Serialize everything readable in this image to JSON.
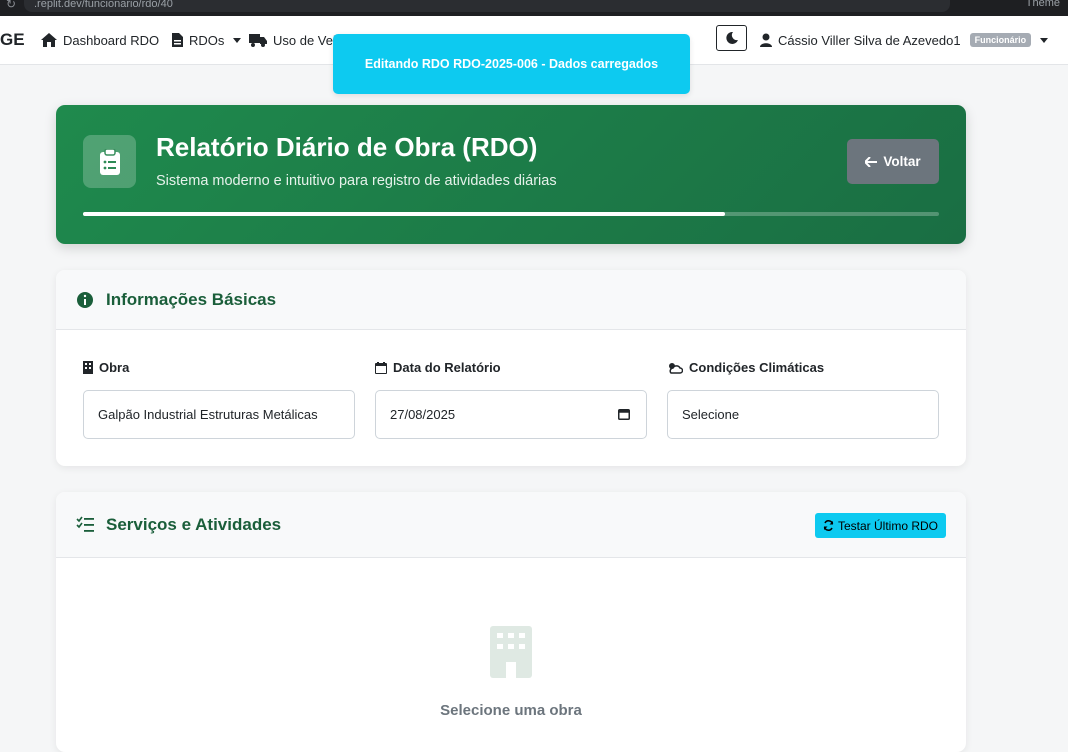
{
  "browser": {
    "url": ".replit.dev/funcionario/rdo/40",
    "theme_label": "Theme"
  },
  "navbar": {
    "brand": "GE",
    "dashboard_label": "Dashboard RDO",
    "rdos_label": "RDOs",
    "vehicles_label": "Uso de Vei",
    "user_name": "Cássio Viller Silva de Azevedo1",
    "user_role": "Funcionário"
  },
  "toast": {
    "message": "Editando RDO RDO-2025-006 - Dados carregados"
  },
  "hero": {
    "title": "Relatório Diário de Obra (RDO)",
    "subtitle": "Sistema moderno e intuitivo para registro de atividades diárias",
    "back_label": "Voltar",
    "progress_fraction": 0.75
  },
  "basic_info": {
    "title": "Informações Básicas",
    "obra_label": "Obra",
    "obra_value": "Galpão Industrial Estruturas Metálicas",
    "date_label": "Data do Relatório",
    "date_value": "27/08/2025",
    "weather_label": "Condições Climáticas",
    "weather_value": "Selecione"
  },
  "services": {
    "title": "Serviços e Atividades",
    "test_button": "Testar Último RDO",
    "empty_text": "Selecione uma obra"
  },
  "colors": {
    "primary_green": "#1d7f48",
    "info_cyan": "#0dcaf0",
    "secondary_gray": "#6c757d"
  }
}
